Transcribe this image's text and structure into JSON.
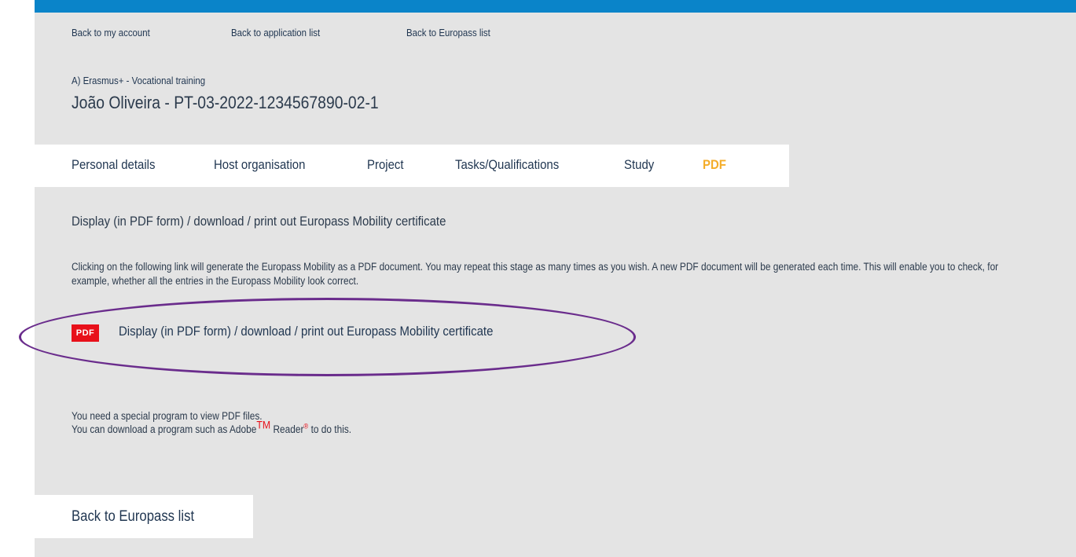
{
  "nav": {
    "back_account": "Back to my account",
    "back_applications": "Back to application list",
    "back_europass": "Back to Europass list"
  },
  "record": {
    "program": "A) Erasmus+ - Vocational training",
    "title": "João Oliveira - PT-03-2022-1234567890-02-1"
  },
  "tabs": [
    {
      "label": "Personal details"
    },
    {
      "label": "Host organisation"
    },
    {
      "label": "Project"
    },
    {
      "label": "Tasks/Qualifications"
    },
    {
      "label": "Study"
    },
    {
      "label": "PDF"
    }
  ],
  "content": {
    "heading": "Display (in PDF form) / download / print out Europass Mobility certificate",
    "info": "Clicking on the following link will generate the Europass Mobility as a PDF document. You may repeat this stage as many times as you wish. A new PDF document will be generated each time. This will enable you to check, for example, whether all the entries in the Europass Mobility look correct.",
    "pdf_badge": "PDF",
    "pdf_link": "Display (in PDF form) / download / print out Europass Mobility certificate",
    "note_line1": "You need a special program to view PDF files.",
    "note_line2_a": "You can download a program such as Adobe",
    "note_tm": "TM",
    "note_line2_b": " Reader",
    "note_reg": "®",
    "note_line2_c": " to do this."
  },
  "footer": {
    "back_europass": "Back to Europass list"
  },
  "colors": {
    "accent_bar": "#0a84c9",
    "active_tab": "#f4ad2a",
    "pdf_badge": "#e8101a",
    "highlight_ellipse": "#6a2c8c"
  }
}
